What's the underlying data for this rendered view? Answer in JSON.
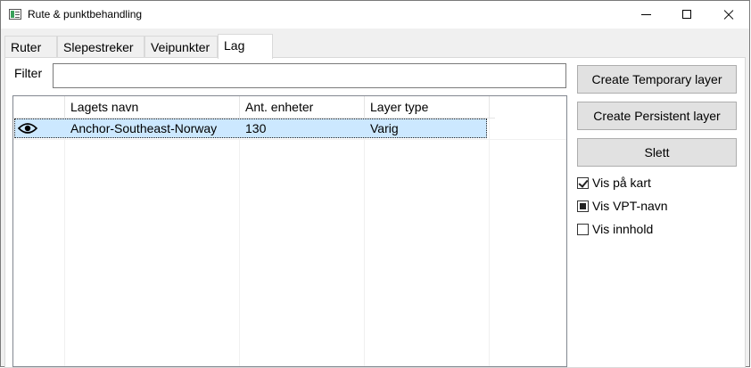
{
  "window": {
    "title": "Rute & punktbehandling",
    "icon": "app-window-icon"
  },
  "tabs": [
    {
      "label": "Ruter",
      "active": false
    },
    {
      "label": "Slepestreker",
      "active": false
    },
    {
      "label": "Veipunkter",
      "active": false
    },
    {
      "label": "Lag",
      "active": true
    }
  ],
  "filter": {
    "label": "Filter",
    "value": ""
  },
  "table": {
    "columns": [
      "",
      "Lagets navn",
      "Ant. enheter",
      "Layer type"
    ],
    "rows": [
      {
        "visible_icon": "eye-icon",
        "name": "Anchor-Southeast-Norway",
        "count": "130",
        "type": "Varig",
        "selected": true
      }
    ]
  },
  "actions": {
    "create_temporary": "Create Temporary layer",
    "create_persistent": "Create Persistent layer",
    "delete": "Slett"
  },
  "options": [
    {
      "label": "Vis på kart",
      "state": "checked"
    },
    {
      "label": "Vis VPT-navn",
      "state": "indeterminate"
    },
    {
      "label": "Vis innhold",
      "state": "unchecked"
    }
  ],
  "colors": {
    "selection": "#cce8ff",
    "button_bg": "#e1e1e1",
    "window_bg": "#f0f0f0"
  }
}
